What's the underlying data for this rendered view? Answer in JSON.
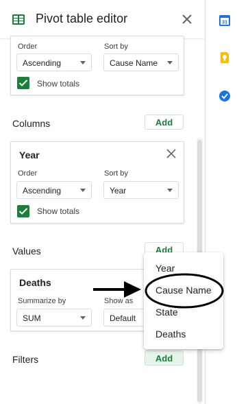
{
  "header": {
    "title": "Pivot table editor"
  },
  "rows_card": {
    "order_label": "Order",
    "order_value": "Ascending",
    "sort_label": "Sort by",
    "sort_value": "Cause Name",
    "show_totals": "Show totals"
  },
  "columns_section": {
    "label": "Columns",
    "add_label": "Add",
    "card": {
      "title": "Year",
      "order_label": "Order",
      "order_value": "Ascending",
      "sort_label": "Sort by",
      "sort_value": "Year",
      "show_totals": "Show totals"
    }
  },
  "values_section": {
    "label": "Values",
    "add_label": "Add",
    "card": {
      "title": "Deaths",
      "summarize_label": "Summarize by",
      "summarize_value": "SUM",
      "show_as_label": "Show as",
      "show_as_value": "Default"
    }
  },
  "filters_section": {
    "label": "Filters",
    "add_label": "Add"
  },
  "dropdown_menu": {
    "items": [
      "Year",
      "Cause Name",
      "State",
      "Deaths"
    ]
  },
  "side_panel": {
    "icons": [
      "calendar-icon",
      "keep-icon",
      "tasks-icon"
    ]
  },
  "colors": {
    "accent_green": "#188038",
    "calendar_blue": "#1a73e8",
    "keep_yellow": "#fbbc04",
    "tasks_blue": "#1a73e8"
  }
}
